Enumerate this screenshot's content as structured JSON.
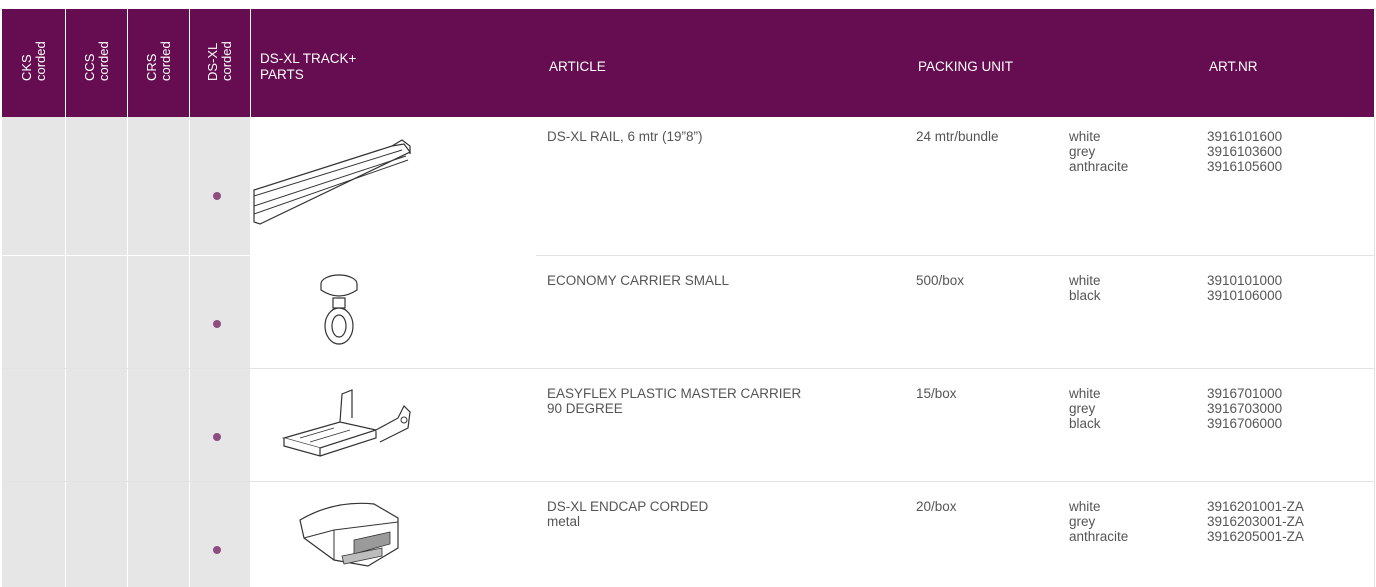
{
  "header": {
    "col_cks": "CKS\ncorded",
    "col_ccs": "CCS\ncorded",
    "col_crs": "CRS\ncorded",
    "col_dsxl": "DS-XL\ncorded",
    "track_parts": "DS-XL TRACK+\nPARTS",
    "article": "ARTICLE",
    "packing_unit": "PACKING UNIT",
    "art_nr": "ART.NR"
  },
  "rows": [
    {
      "article": "DS-XL RAIL, 6 mtr (19”8”)",
      "packing": "24 mtr/bundle",
      "colors": "white\ngrey\nanthracite",
      "artnr": "3916101600\n3916103600\n3916105600",
      "image": "rail-icon"
    },
    {
      "article": "ECONOMY CARRIER SMALL",
      "packing": "500/box",
      "colors": "white\nblack",
      "artnr": "3910101000\n3910106000",
      "image": "carrier-icon"
    },
    {
      "article": "EASYFLEX PLASTIC MASTER CARRIER\n90 DEGREE",
      "packing": "15/box",
      "colors": "white\ngrey\nblack",
      "artnr": "3916701000\n3916703000\n3916706000",
      "image": "master-carrier-icon"
    },
    {
      "article": "DS-XL ENDCAP CORDED\nmetal",
      "packing": "20/box",
      "colors": "white\ngrey\nanthracite",
      "artnr": "3916201001-ZA\n3916203001-ZA\n3916205001-ZA",
      "image": "endcap-icon"
    }
  ],
  "colors": {
    "header_bg": "#660c50",
    "dot": "#8e4d80",
    "shade": "#e6e6e6"
  }
}
